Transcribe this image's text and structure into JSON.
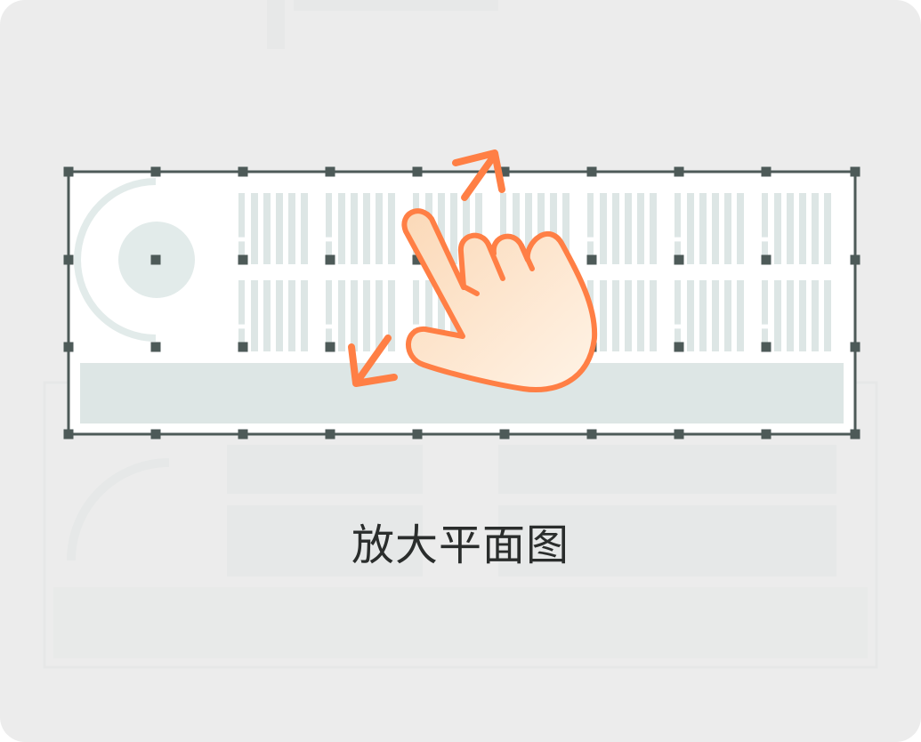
{
  "instruction": {
    "caption": "放大平面图"
  },
  "gesture": {
    "type": "pinch-to-zoom",
    "icon": "hand-pointer-icon",
    "arrows": [
      "expand-up-right-arrow-icon",
      "expand-down-left-arrow-icon"
    ]
  },
  "colors": {
    "background": "#ececec",
    "panel": "#ffffff",
    "blueprint_fill": "#dde6e5",
    "selection_stroke": "#4d5a58",
    "accent": "#ff7f45",
    "hand_fill": "#fde6cf",
    "caption_text": "#2a2d2c"
  }
}
